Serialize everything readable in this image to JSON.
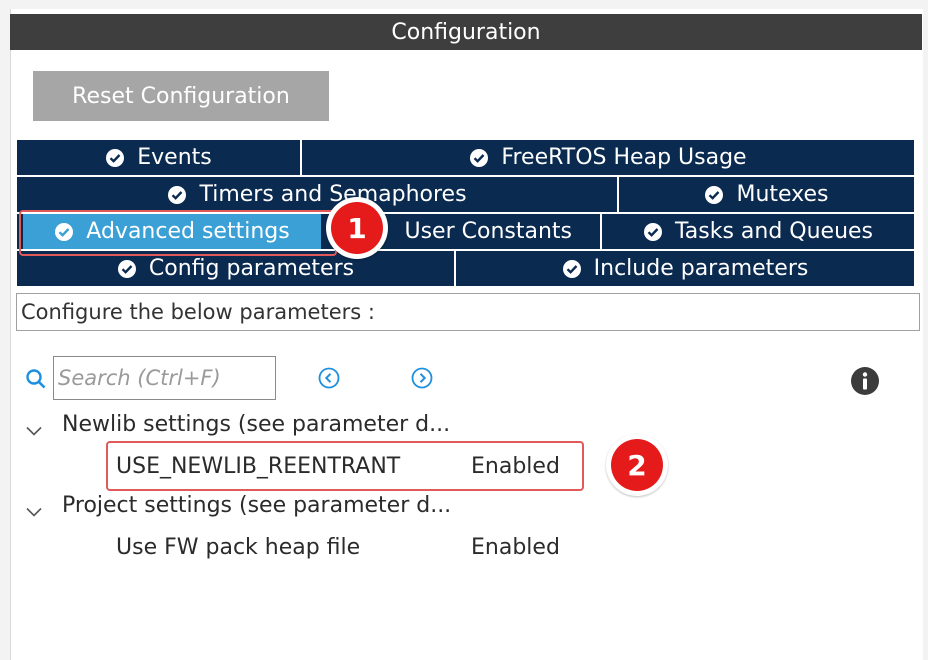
{
  "panel": {
    "title": "Configuration"
  },
  "toolbar": {
    "reset_label": "Reset Configuration"
  },
  "tabs": {
    "events": "Events",
    "heap_usage": "FreeRTOS Heap Usage",
    "timers": "Timers and Semaphores",
    "mutexes": "Mutexes",
    "advanced": "Advanced settings",
    "user_constants": "User Constants",
    "tasks_queues": "Tasks and Queues",
    "config_params": "Config parameters",
    "include_params": "Include parameters",
    "active_tab": "Advanced settings"
  },
  "description": "Configure the below parameters :",
  "search": {
    "placeholder": "Search (Ctrl+F)"
  },
  "tree": {
    "groups": [
      {
        "label": "Newlib settings (see parameter d...",
        "params": [
          {
            "name": "USE_NEWLIB_REENTRANT",
            "value": "Enabled"
          }
        ]
      },
      {
        "label": "Project settings (see parameter d...",
        "params": [
          {
            "name": "Use FW pack heap file",
            "value": "Enabled"
          }
        ]
      }
    ]
  },
  "callouts": {
    "step1": "1",
    "step2": "2"
  },
  "colors": {
    "tab_bg": "#0a2a50",
    "tab_active": "#3aa0d6",
    "accent": "#1e90e0",
    "callout": "#e51b1b",
    "check": "#7cc242"
  },
  "icons": {
    "tab_status": "check-circle-icon",
    "search": "search-icon",
    "prev": "chevron-left-circle-icon",
    "next": "chevron-right-circle-icon",
    "info": "info-icon",
    "expand": "chevron-down-icon"
  }
}
